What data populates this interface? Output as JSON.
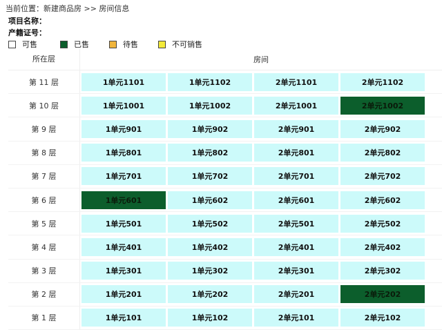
{
  "breadcrumb": "当前位置：新建商品房 >> 房间信息",
  "project": {
    "name_label": "项目名称：",
    "cert_label": "产籍证号："
  },
  "legend": [
    {
      "label": "可售",
      "color": "#ffffff"
    },
    {
      "label": "已售",
      "color": "#0c5e2c"
    },
    {
      "label": "待售",
      "color": "#f0b53c"
    },
    {
      "label": "不可销售",
      "color": "#f3ea3a"
    }
  ],
  "table": {
    "col_floor": "所在层",
    "col_rooms": "房间",
    "rows": [
      {
        "floor": "第 11 层",
        "rooms": [
          {
            "name": "1单元1101",
            "status": "available"
          },
          {
            "name": "1单元1102",
            "status": "available"
          },
          {
            "name": "2单元1101",
            "status": "available"
          },
          {
            "name": "2单元1102",
            "status": "available"
          }
        ]
      },
      {
        "floor": "第 10 层",
        "rooms": [
          {
            "name": "1单元1001",
            "status": "available"
          },
          {
            "name": "1单元1002",
            "status": "available"
          },
          {
            "name": "2单元1001",
            "status": "available"
          },
          {
            "name": "2单元1002",
            "status": "sold"
          }
        ]
      },
      {
        "floor": "第 9 层",
        "rooms": [
          {
            "name": "1单元901",
            "status": "available"
          },
          {
            "name": "1单元902",
            "status": "available"
          },
          {
            "name": "2单元901",
            "status": "available"
          },
          {
            "name": "2单元902",
            "status": "available"
          }
        ]
      },
      {
        "floor": "第 8 层",
        "rooms": [
          {
            "name": "1单元801",
            "status": "available"
          },
          {
            "name": "1单元802",
            "status": "available"
          },
          {
            "name": "2单元801",
            "status": "available"
          },
          {
            "name": "2单元802",
            "status": "available"
          }
        ]
      },
      {
        "floor": "第 7 层",
        "rooms": [
          {
            "name": "1单元701",
            "status": "available"
          },
          {
            "name": "1单元702",
            "status": "available"
          },
          {
            "name": "2单元701",
            "status": "available"
          },
          {
            "name": "2单元702",
            "status": "available"
          }
        ]
      },
      {
        "floor": "第 6 层",
        "rooms": [
          {
            "name": "1单元601",
            "status": "sold"
          },
          {
            "name": "1单元602",
            "status": "available"
          },
          {
            "name": "2单元601",
            "status": "available"
          },
          {
            "name": "2单元602",
            "status": "available"
          }
        ]
      },
      {
        "floor": "第 5 层",
        "rooms": [
          {
            "name": "1单元501",
            "status": "available"
          },
          {
            "name": "1单元502",
            "status": "available"
          },
          {
            "name": "2单元501",
            "status": "available"
          },
          {
            "name": "2单元502",
            "status": "available"
          }
        ]
      },
      {
        "floor": "第 4 层",
        "rooms": [
          {
            "name": "1单元401",
            "status": "available"
          },
          {
            "name": "1单元402",
            "status": "available"
          },
          {
            "name": "2单元401",
            "status": "available"
          },
          {
            "name": "2单元402",
            "status": "available"
          }
        ]
      },
      {
        "floor": "第 3 层",
        "rooms": [
          {
            "name": "1单元301",
            "status": "available"
          },
          {
            "name": "1单元302",
            "status": "available"
          },
          {
            "name": "2单元301",
            "status": "available"
          },
          {
            "name": "2单元302",
            "status": "available"
          }
        ]
      },
      {
        "floor": "第 2 层",
        "rooms": [
          {
            "name": "1单元201",
            "status": "available"
          },
          {
            "name": "1单元202",
            "status": "available"
          },
          {
            "name": "2单元201",
            "status": "available"
          },
          {
            "name": "2单元202",
            "status": "sold"
          }
        ]
      },
      {
        "floor": "第 1 层",
        "rooms": [
          {
            "name": "1单元101",
            "status": "available"
          },
          {
            "name": "1单元102",
            "status": "available"
          },
          {
            "name": "2单元101",
            "status": "available"
          },
          {
            "name": "2单元102",
            "status": "available"
          }
        ]
      }
    ]
  }
}
